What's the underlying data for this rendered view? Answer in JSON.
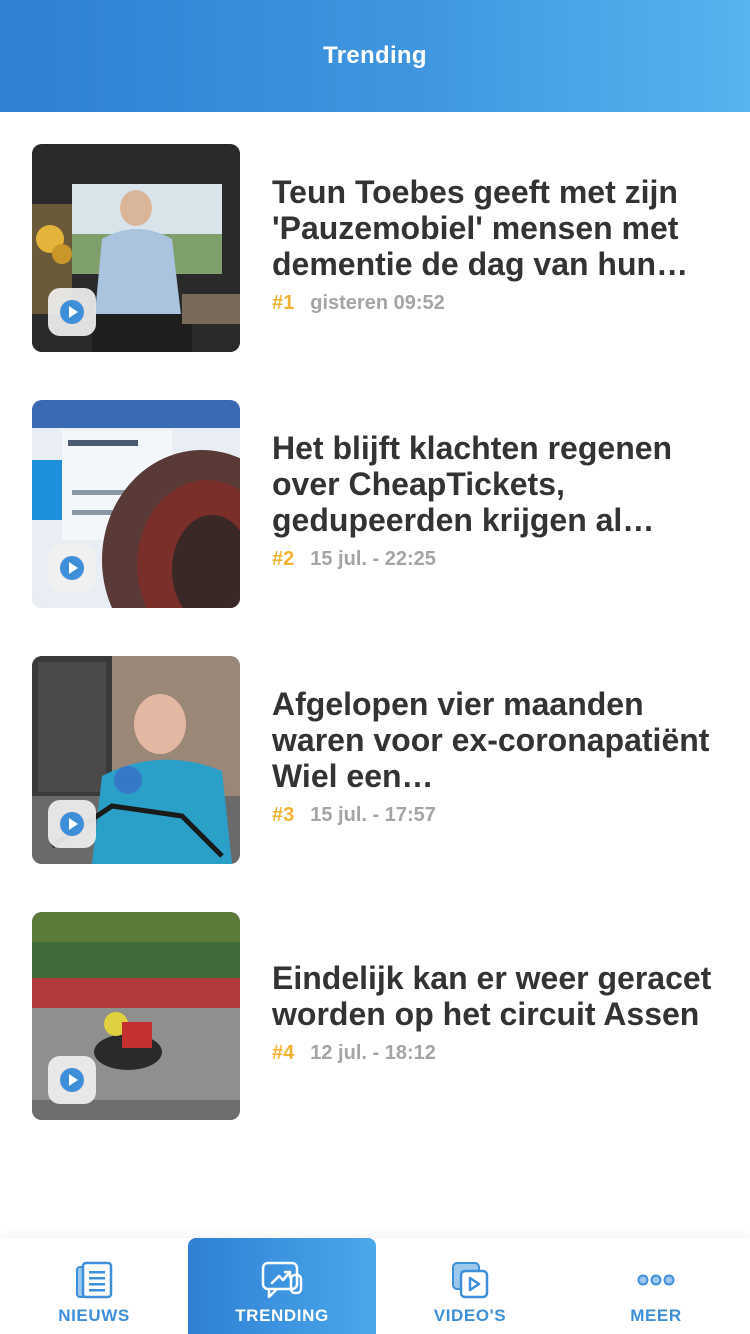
{
  "header": {
    "title": "Trending"
  },
  "articles": [
    {
      "rank": "#1",
      "title": "Teun Toebes geeft met zijn 'Pauzemobiel' mensen met dementie de dag van hun…",
      "time": "gisteren 09:52"
    },
    {
      "rank": "#2",
      "title": "Het blijft klachten regenen over CheapTickets, gedupeerden krijgen al…",
      "time": "15 jul. - 22:25"
    },
    {
      "rank": "#3",
      "title": "Afgelopen vier maanden waren voor ex-coronapatiënt Wiel een…",
      "time": "15 jul. - 17:57"
    },
    {
      "rank": "#4",
      "title": "Eindelijk kan er weer geracet worden op het circuit Assen",
      "time": "12 jul. - 18:12"
    }
  ],
  "tabbar": {
    "items": [
      {
        "label": "NIEUWS",
        "icon": "news-icon"
      },
      {
        "label": "TRENDING",
        "icon": "trending-icon",
        "active": true
      },
      {
        "label": "VIDEO'S",
        "icon": "video-icon"
      },
      {
        "label": "MEER",
        "icon": "more-icon"
      }
    ]
  },
  "colors": {
    "accent": "#3d8fd8",
    "rank": "#f2b233",
    "meta": "#a5a5a5",
    "title": "#333333"
  }
}
